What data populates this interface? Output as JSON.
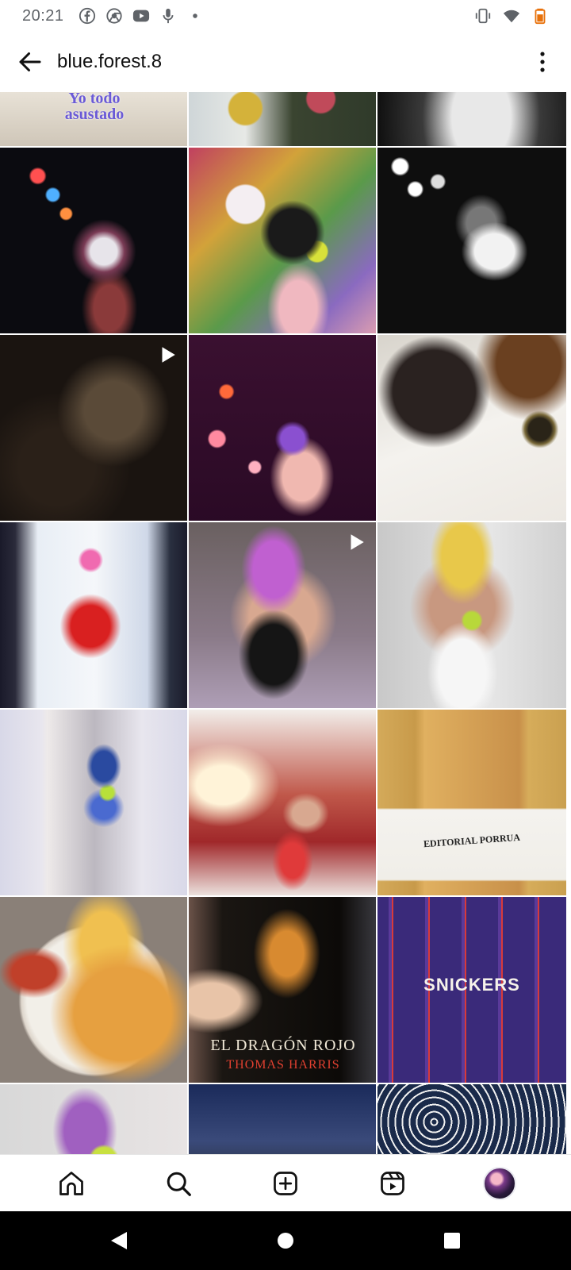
{
  "status_bar": {
    "time": "20:21",
    "left_icons": [
      "facebook-icon",
      "chrome-icon",
      "youtube-icon",
      "microphone-icon",
      "dot-icon"
    ],
    "right_icons": [
      "vibrate-icon",
      "wifi-icon",
      "battery-icon"
    ]
  },
  "header": {
    "title": "blue.forest.8",
    "back_icon": "arrow-left-icon",
    "more_icon": "more-vertical-icon"
  },
  "grid": {
    "rows": [
      [
        {
          "name": "post-text-scared",
          "overlay_text": [
            "Yo todo",
            "asustado"
          ]
        },
        {
          "name": "post-stickers"
        },
        {
          "name": "post-bw-pose"
        }
      ],
      [
        {
          "name": "post-dancer-night"
        },
        {
          "name": "post-mirror-selfie-stickers"
        },
        {
          "name": "post-bw-dancer"
        }
      ],
      [
        {
          "name": "post-dark-video",
          "video": true
        },
        {
          "name": "post-dancer-lights"
        },
        {
          "name": "post-calico-cat"
        }
      ],
      [
        {
          "name": "post-red-outfit-mirror"
        },
        {
          "name": "post-pink-hair-video",
          "video": true
        },
        {
          "name": "post-blonde-selfie"
        }
      ],
      [
        {
          "name": "post-blue-hat-collage"
        },
        {
          "name": "post-red-room"
        },
        {
          "name": "post-editorial-porrua",
          "overlay_text": [
            "EDITORIAL PORRUA"
          ]
        }
      ],
      [
        {
          "name": "post-hotdog-pizza"
        },
        {
          "name": "post-book-dragon",
          "overlay_text": [
            "EL DRAGÓN ROJO",
            "THOMAS HARRIS"
          ]
        },
        {
          "name": "post-snickers",
          "overlay_text": [
            "SNICKERS"
          ]
        }
      ],
      [
        {
          "name": "post-partial-selfie"
        },
        {
          "name": "post-partial-screen"
        },
        {
          "name": "post-partial-floral"
        }
      ]
    ]
  },
  "bottom_nav": {
    "items": [
      "home-icon",
      "search-icon",
      "add-post-icon",
      "reels-icon",
      "profile-avatar"
    ]
  },
  "system_nav": {
    "items": [
      "back-triangle-icon",
      "home-circle-icon",
      "recents-square-icon"
    ]
  },
  "colors": {
    "background": "#ffffff",
    "text": "#111111",
    "status_icons": "#5f6368",
    "system_nav": "#000000"
  }
}
